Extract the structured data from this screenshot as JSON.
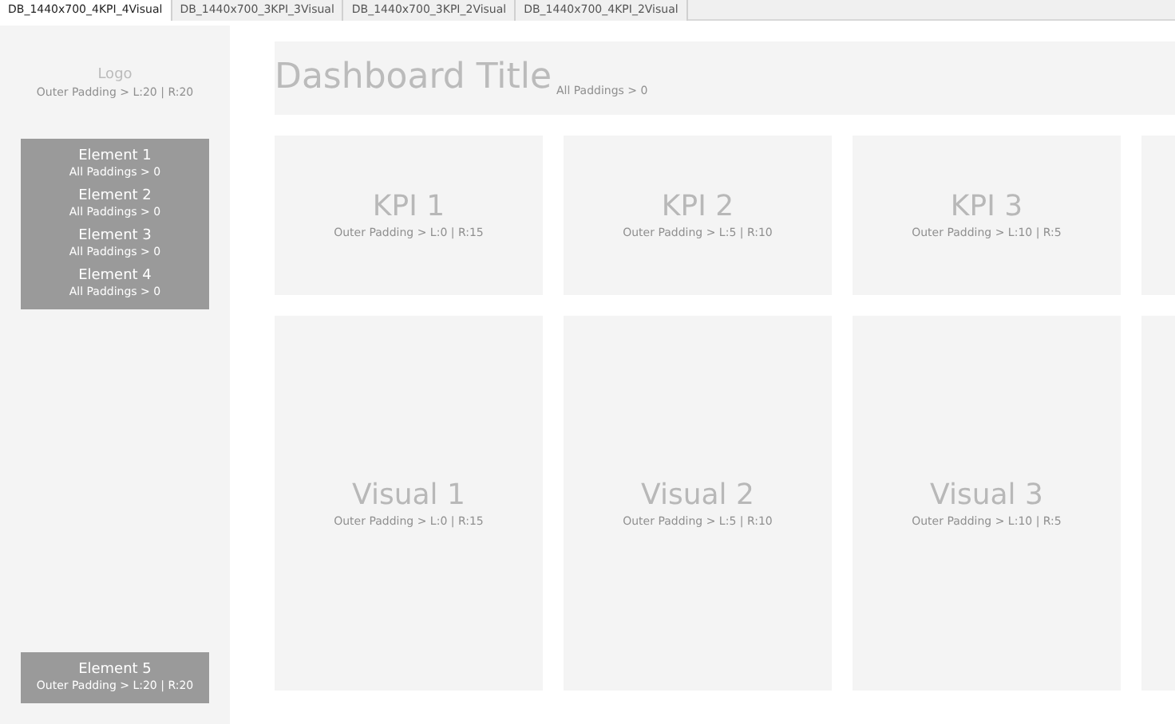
{
  "tabs": [
    {
      "label": "DB_1440x700_4KPI_4Visual",
      "selected": true
    },
    {
      "label": "DB_1440x700_3KPI_3Visual",
      "selected": false
    },
    {
      "label": "DB_1440x700_3KPI_2Visual",
      "selected": false
    },
    {
      "label": "DB_1440x700_4KPI_2Visual",
      "selected": false
    }
  ],
  "sidebar": {
    "logo": {
      "title": "Logo",
      "note": "Outer Padding > L:20 | R:20"
    },
    "elements": [
      {
        "title": "Element 1",
        "note": "All Paddings > 0"
      },
      {
        "title": "Element 2",
        "note": "All Paddings > 0"
      },
      {
        "title": "Element 3",
        "note": "All Paddings > 0"
      },
      {
        "title": "Element 4",
        "note": "All Paddings > 0"
      }
    ],
    "footer_element": {
      "title": "Element 5",
      "note": "Outer Padding > L:20 | R:20"
    }
  },
  "header": {
    "title": "Dashboard Title",
    "note": "All Paddings > 0"
  },
  "kpis": [
    {
      "title": "KPI 1",
      "note": "Outer Padding > L:0 | R:15"
    },
    {
      "title": "KPI 2",
      "note": "Outer Padding > L:5 | R:10"
    },
    {
      "title": "KPI 3",
      "note": "Outer Padding > L:10 | R:5"
    }
  ],
  "visuals": [
    {
      "title": "Visual 1",
      "note": "Outer Padding > L:0 | R:15"
    },
    {
      "title": "Visual 2",
      "note": "Outer Padding > L:5 | R:10"
    },
    {
      "title": "Visual 3",
      "note": "Outer Padding > L:10 | R:5"
    }
  ]
}
